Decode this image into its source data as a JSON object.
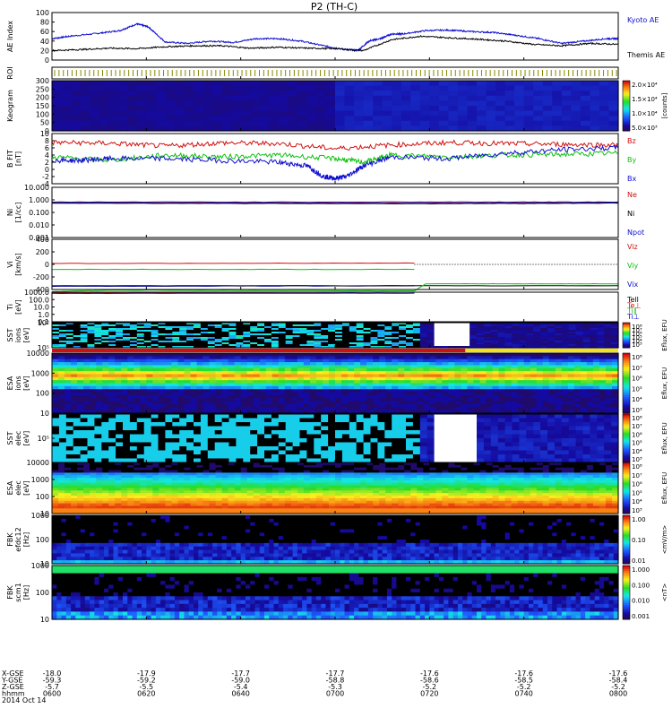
{
  "title": "P2 (TH-C)",
  "colors": {
    "blue": "#1010d0",
    "red": "#d01010",
    "green": "#10c010",
    "black": "#000000",
    "yellow": "#f5e21a",
    "spec_bg": "#2a0a4a"
  },
  "footer": {
    "row_labels": [
      "X-GSE",
      "Y-GSE",
      "Z-GSE",
      "hhmm",
      "2014 Oct 14"
    ],
    "ticks": [
      {
        "x": "-18.0",
        "y": "-59.3",
        "z": "-5.7",
        "t": "0600"
      },
      {
        "x": "-17.9",
        "y": "-59.2",
        "z": "-5.5",
        "t": "0620"
      },
      {
        "x": "-17.7",
        "y": "-59.0",
        "z": "-5.4",
        "t": "0640"
      },
      {
        "x": "-17.7",
        "y": "-58.8",
        "z": "-5.3",
        "t": "0700"
      },
      {
        "x": "-17.6",
        "y": "-58.6",
        "z": "-5.2",
        "t": "0720"
      },
      {
        "x": "-17.6",
        "y": "-58.5",
        "z": "-5.2",
        "t": "0740"
      },
      {
        "x": "-17.6",
        "y": "-58.4",
        "z": "-5.2",
        "t": "0800"
      }
    ]
  },
  "chart_data": [
    {
      "type": "line",
      "ylabel": "AE Index",
      "ylim": [
        0,
        100
      ],
      "yticks": [
        "100",
        "80",
        "60",
        "40",
        "20",
        "0"
      ],
      "series": [
        {
          "name": "Kyoto AE",
          "color": "blue",
          "x": [
            0,
            3,
            8,
            12,
            15,
            17,
            20,
            24,
            28,
            32,
            36,
            40,
            44,
            48,
            52,
            54,
            56,
            58,
            60,
            62,
            66,
            70,
            74,
            78,
            82,
            86,
            90,
            94,
            98,
            100
          ],
          "y": [
            45,
            50,
            56,
            62,
            76,
            70,
            38,
            35,
            40,
            37,
            45,
            45,
            40,
            30,
            22,
            20,
            40,
            45,
            55,
            55,
            62,
            63,
            60,
            58,
            52,
            45,
            35,
            40,
            45,
            45
          ]
        },
        {
          "name": "Themis AE",
          "color": "black",
          "x": [
            0,
            5,
            10,
            15,
            20,
            25,
            30,
            35,
            40,
            45,
            50,
            55,
            60,
            65,
            70,
            75,
            80,
            85,
            90,
            95,
            100
          ],
          "y": [
            20,
            22,
            25,
            24,
            28,
            30,
            30,
            25,
            27,
            25,
            24,
            20,
            43,
            50,
            47,
            44,
            40,
            33,
            30,
            35,
            33
          ]
        }
      ]
    },
    {
      "type": "bar",
      "ylabel": "ROI",
      "pattern": "dotted"
    },
    {
      "type": "heatmap",
      "ylabel": "Keogram",
      "ylim": [
        0,
        300
      ],
      "yticks": [
        "300",
        "250",
        "200",
        "150",
        "100",
        "50",
        "0"
      ],
      "colorbar": {
        "labels": [
          "2.0×10⁴",
          "1.5×10⁴",
          "1.0×10⁴",
          "5.0×10³"
        ],
        "title": "[counts]"
      }
    },
    {
      "type": "line",
      "ylabel": "B FIT\n[nT]",
      "ylim": [
        -4,
        10
      ],
      "yticks": [
        "10",
        "8",
        "6",
        "4",
        "2",
        "0",
        "-2",
        "-4"
      ],
      "series": [
        {
          "name": "Bz",
          "color": "red",
          "x": [
            0,
            10,
            20,
            30,
            40,
            50,
            60,
            70,
            80,
            90,
            100
          ],
          "y": [
            7.5,
            7.3,
            6.5,
            7.4,
            7.2,
            5.8,
            6.8,
            7.5,
            7.2,
            7.0,
            6.8
          ]
        },
        {
          "name": "By",
          "color": "green",
          "x": [
            0,
            10,
            20,
            30,
            40,
            50,
            55,
            60,
            70,
            80,
            90,
            100
          ],
          "y": [
            3.5,
            2.5,
            4.0,
            3.5,
            4.0,
            3.0,
            2.0,
            4.0,
            3.5,
            4.0,
            4.2,
            4.5
          ]
        },
        {
          "name": "Bx",
          "color": "blue",
          "x": [
            0,
            5,
            10,
            20,
            30,
            40,
            45,
            48,
            50,
            52,
            55,
            60,
            70,
            80,
            90,
            100
          ],
          "y": [
            2.5,
            2.5,
            3.0,
            3.0,
            2.5,
            2.0,
            1.0,
            -2.0,
            -2.5,
            -2.0,
            1.0,
            3.5,
            3.0,
            4.5,
            5.5,
            6.0
          ]
        }
      ]
    },
    {
      "type": "line",
      "ylabel": "Ni\n[1/cc]",
      "yscale": "log",
      "yticks": [
        "10.000",
        "1.000",
        "0.100",
        "0.010",
        "0.001"
      ],
      "series": [
        {
          "name": "Ne",
          "color": "red",
          "x": [
            0,
            65,
            100
          ],
          "y": [
            -0.1,
            -0.15,
            -0.1
          ]
        },
        {
          "name": "Ni",
          "color": "black",
          "x": [
            0,
            65,
            100
          ],
          "y": [
            -0.15,
            -0.2,
            -0.15
          ]
        },
        {
          "name": "Npot",
          "color": "blue",
          "x": [
            0,
            65,
            100
          ],
          "y": [
            -0.05,
            -0.05,
            -0.05
          ]
        }
      ]
    },
    {
      "type": "line",
      "ylabel": "Vi\n[km/s]",
      "ylim": [
        -400,
        400
      ],
      "yticks": [
        "400",
        "200",
        "0",
        "-200",
        "-400"
      ],
      "series": [
        {
          "name": "Viz",
          "color": "red",
          "x": [
            0,
            64
          ],
          "y": [
            15,
            20
          ]
        },
        {
          "name": "Viy",
          "color": "green",
          "x": [
            0,
            64
          ],
          "y": [
            -80,
            -80
          ]
        },
        {
          "name": "Vix",
          "color": "blue",
          "x": [
            0,
            64
          ],
          "y": [
            -350,
            -340
          ]
        }
      ]
    },
    {
      "type": "line",
      "ylabel": "Ti\n[eV]",
      "yscale": "log",
      "yticks": [
        "1000.0",
        "100.0",
        "10.0",
        "1.0",
        "0.1"
      ],
      "series": [
        {
          "name": "Tell",
          "color": "black",
          "x": [
            0,
            100
          ],
          "y": [
            2.3,
            2.3
          ]
        },
        {
          "name": "Te⊥",
          "color": "red",
          "x": [
            0,
            64
          ],
          "y": [
            1.2,
            1.3
          ]
        },
        {
          "name": "Ti∥",
          "color": "green",
          "x": [
            0,
            10,
            64,
            66,
            100
          ],
          "y": [
            1.4,
            1.6,
            1.5,
            2.6,
            2.6
          ]
        },
        {
          "name": "Ti⊥",
          "color": "blue",
          "x": [
            0,
            64
          ],
          "y": [
            1.1,
            1.15
          ]
        }
      ]
    },
    {
      "type": "heatmap",
      "ylabel": "SST\nions\n[eV]",
      "yticks": [
        "10⁶",
        "10⁵"
      ],
      "colorbar": {
        "labels": [
          "10⁸",
          "10⁷",
          "10⁶",
          "10⁵",
          "10⁴",
          "10³"
        ],
        "title": "Eflux, EFU"
      }
    },
    {
      "type": "heatmap",
      "ylabel": "ESA\nions\n[eV]",
      "yticks": [
        "10000",
        "1000",
        "100",
        "10"
      ],
      "colorbar": {
        "labels": [
          "10⁸",
          "10⁷",
          "10⁶",
          "10⁵",
          "10⁴",
          "10³"
        ],
        "title": "Eflux, EFU"
      }
    },
    {
      "type": "heatmap",
      "ylabel": "SST\nelec\n[eV]",
      "yticks": [
        "10⁵"
      ],
      "colorbar": {
        "labels": [
          "10⁸",
          "10⁷",
          "10⁶",
          "10⁵",
          "10⁴",
          "10³"
        ],
        "title": "Eflux, EFU"
      }
    },
    {
      "type": "heatmap",
      "ylabel": "ESA\nelec\n[eV]",
      "yticks": [
        "10000",
        "1000",
        "100",
        "10"
      ],
      "colorbar": {
        "labels": [
          "10⁸",
          "10⁷",
          "10⁶",
          "10⁵",
          "10⁴",
          "10³"
        ],
        "title": "Eflux, EFU"
      }
    },
    {
      "type": "heatmap",
      "ylabel": "FBK\nefdc12\n[Hz]",
      "yticks": [
        "1000",
        "100",
        "10"
      ],
      "colorbar": {
        "labels": [
          "1.00",
          "0.10",
          "0.01"
        ],
        "title": "<mV/m>"
      }
    },
    {
      "type": "heatmap",
      "ylabel": "FBK\nscm1\n[Hz]",
      "yticks": [
        "1000",
        "100",
        "10"
      ],
      "colorbar": {
        "labels": [
          "1.000",
          "0.100",
          "0.010",
          "0.001"
        ],
        "title": "<nT>"
      }
    }
  ]
}
